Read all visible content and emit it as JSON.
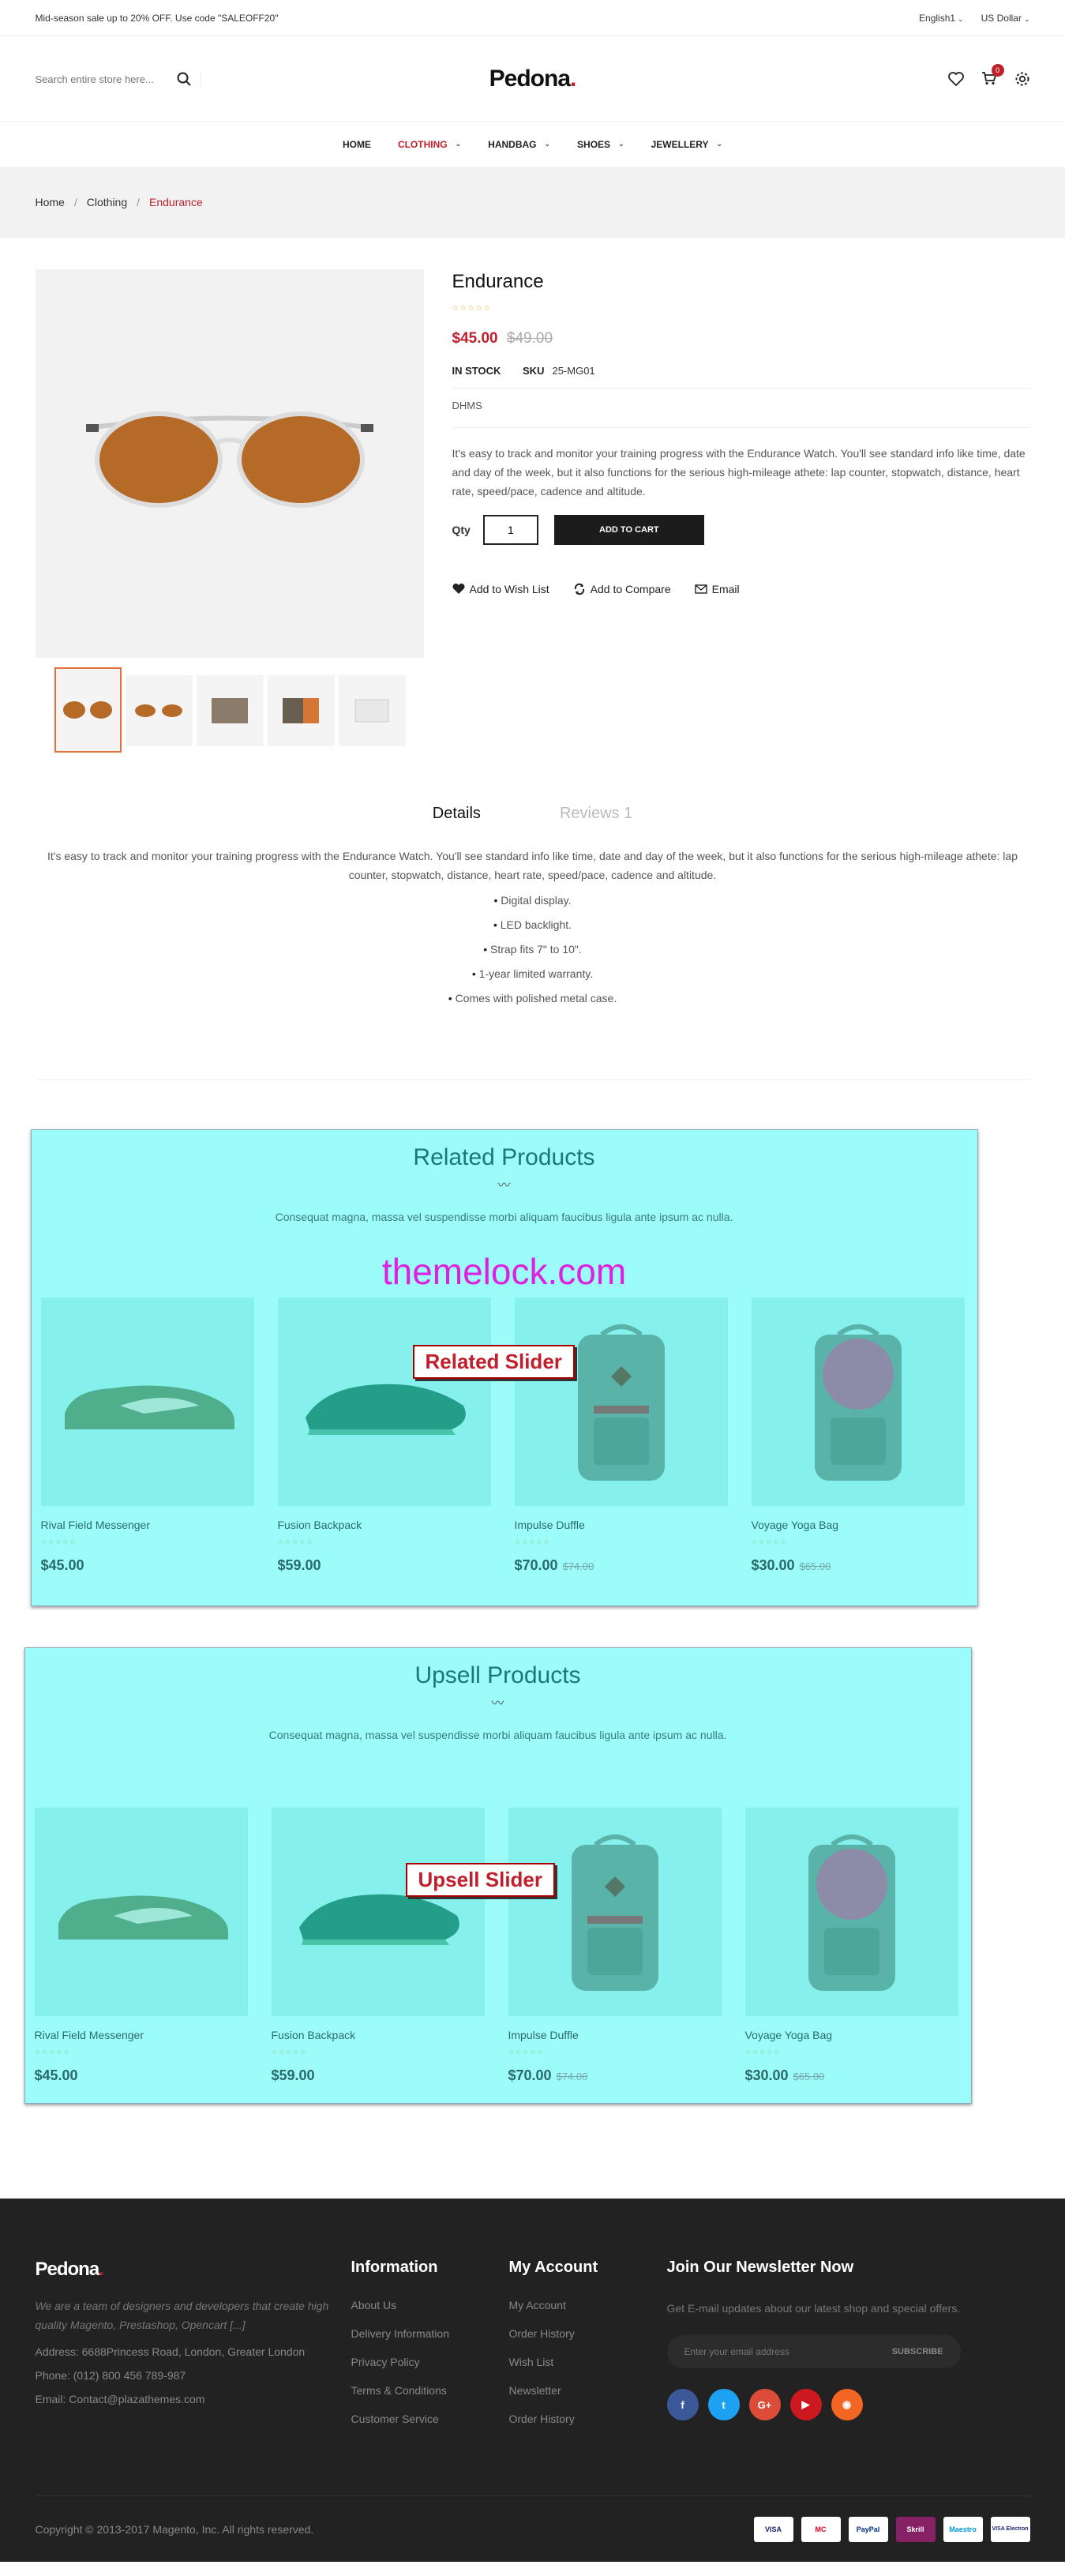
{
  "topbar": {
    "promo": "Mid-season sale up to 20% OFF. Use code \"SALEOFF20\"",
    "language": "English1",
    "currency": "US Dollar"
  },
  "header": {
    "search_placeholder": "Search entire store here...",
    "logo": "Pedona",
    "logo_dot": ".",
    "cart_count": "0"
  },
  "nav": {
    "items": [
      {
        "label": "HOME"
      },
      {
        "label": "CLOTHING"
      },
      {
        "label": "HANDBAG"
      },
      {
        "label": "SHOES"
      },
      {
        "label": "JEWELLERY"
      }
    ]
  },
  "breadcrumb": {
    "items": [
      "Home",
      "Clothing",
      "Endurance"
    ],
    "sep": "/"
  },
  "product": {
    "name": "Endurance",
    "stars": "☆☆☆☆☆",
    "price": "$45.00",
    "old_price": "$49.00",
    "stock": "IN STOCK",
    "sku_label": "SKU",
    "sku": "25-MG01",
    "dhms": "DHMS",
    "description": "It's easy to track and monitor your training progress with the Endurance Watch. You'll see standard info like time, date and day of the week, but it also functions for the serious high-mileage athete: lap counter, stopwatch, distance, heart rate, speed/pace, cadence and altitude.",
    "qty_label": "Qty",
    "qty": "1",
    "add_to_cart": "ADD TO CART",
    "wishlist": "Add to Wish List",
    "compare": "Add to Compare",
    "email": "Email"
  },
  "tabs": {
    "details": "Details",
    "reviews": "Reviews 1",
    "details_text": "It's easy to track and monitor your training progress with the Endurance Watch. You'll see standard info like time, date and day of the week, but it also functions for the serious high-mileage athete: lap counter, stopwatch, distance, heart rate, speed/pace, cadence and altitude.",
    "features": [
      "Digital display.",
      "LED backlight.",
      "Strap fits 7\" to 10\".",
      "1-year limited warranty.",
      "Comes with polished metal case."
    ]
  },
  "related": {
    "title": "Related Products",
    "subtitle": "Consequat magna, massa vel suspendisse morbi aliquam faucibus ligula ante ipsum ac nulla.",
    "brand": "themelock.com",
    "label": "Related Slider",
    "products": [
      {
        "name": "Rival Field Messenger",
        "price": "$45.00",
        "old": ""
      },
      {
        "name": "Fusion Backpack",
        "price": "$59.00",
        "old": ""
      },
      {
        "name": "Impulse Duffle",
        "price": "$70.00",
        "old": "$74.00"
      },
      {
        "name": "Voyage Yoga Bag",
        "price": "$30.00",
        "old": "$65.00"
      }
    ]
  },
  "upsell": {
    "title": "Upsell Products",
    "subtitle": "Consequat magna, massa vel suspendisse morbi aliquam faucibus ligula ante ipsum ac nulla.",
    "label": "Upsell Slider",
    "products": [
      {
        "name": "Rival Field Messenger",
        "price": "$45.00",
        "old": ""
      },
      {
        "name": "Fusion Backpack",
        "price": "$59.00",
        "old": ""
      },
      {
        "name": "Impulse Duffle",
        "price": "$70.00",
        "old": "$74.00"
      },
      {
        "name": "Voyage Yoga Bag",
        "price": "$30.00",
        "old": "$65.00"
      }
    ]
  },
  "stars_small": "☆☆☆☆☆",
  "footer": {
    "logo": "Pedona",
    "logo_dot": ".",
    "about": "We are a team of designers and developers that create high quality Magento, Prestashop, Opencart [...]",
    "address": "Address: 6688Princess Road, London, Greater London",
    "phone": "Phone: (012) 800 456 789-987",
    "email": "Email: Contact@plazathemes.com",
    "info_title": "Information",
    "info_links": [
      "About Us",
      "Delivery Information",
      "Privacy Policy",
      "Terms & Conditions",
      "Customer Service"
    ],
    "account_title": "My Account",
    "account_links": [
      "My Account",
      "Order History",
      "Wish List",
      "Newsletter",
      "Order History"
    ],
    "news_title": "Join Our Newsletter Now",
    "news_text": "Get E-mail updates about our latest shop and special offers.",
    "news_placeholder": "Enter your email address",
    "subscribe": "SUBSCRIBE",
    "socials": [
      {
        "glyph": "f",
        "color": "#3b5998"
      },
      {
        "glyph": "t",
        "color": "#1da1f2"
      },
      {
        "glyph": "G+",
        "color": "#dd4b39"
      },
      {
        "glyph": "▶",
        "color": "#cc181e"
      },
      {
        "glyph": "◉",
        "color": "#f26522"
      }
    ],
    "copyright": "Copyright © 2013-2017 Magento, Inc. All rights reserved.",
    "payments": [
      "VISA",
      "MC",
      "PayPal",
      "Skrill",
      "Maestro",
      "VISA Electron"
    ]
  },
  "colors": {
    "accent": "#c0202c",
    "slider_bg": "#9cfcfa",
    "footer_bg": "#222222"
  }
}
